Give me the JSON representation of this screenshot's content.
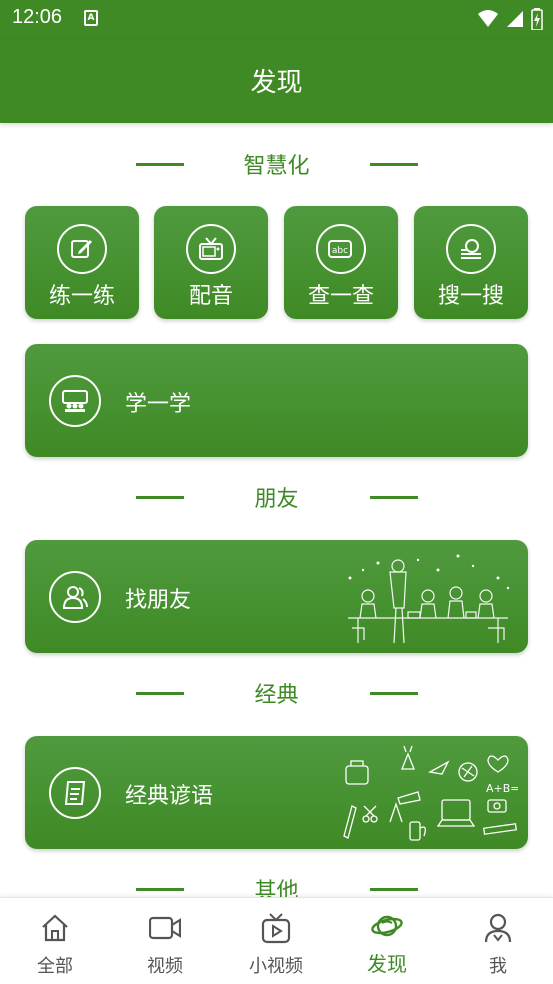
{
  "status_bar": {
    "time": "12:06",
    "notif_icon": "A"
  },
  "app_bar": {
    "title": "发现"
  },
  "sections": {
    "smart": "智慧化",
    "friends": "朋友",
    "classic": "经典",
    "other": "其他"
  },
  "tiles": [
    {
      "label": "练一练",
      "icon": "edit-icon"
    },
    {
      "label": "配音",
      "icon": "tv-icon"
    },
    {
      "label": "查一查",
      "icon": "abc-icon"
    },
    {
      "label": "搜一搜",
      "icon": "search-icon"
    }
  ],
  "cards": {
    "learn": {
      "label": "学一学",
      "icon": "classroom-icon"
    },
    "friends": {
      "label": "找朋友",
      "icon": "people-icon"
    },
    "proverbs": {
      "label": "经典谚语",
      "icon": "scroll-icon"
    }
  },
  "tabs": [
    {
      "label": "全部",
      "icon": "home-icon"
    },
    {
      "label": "视频",
      "icon": "video-camera-icon"
    },
    {
      "label": "小视频",
      "icon": "small-video-icon"
    },
    {
      "label": "发现",
      "icon": "planet-icon",
      "active": true
    },
    {
      "label": "我",
      "icon": "profile-icon"
    }
  ],
  "colors": {
    "brand": "#3f8a25",
    "brand_light": "#4f9a3e",
    "tab_inactive": "#555555"
  }
}
